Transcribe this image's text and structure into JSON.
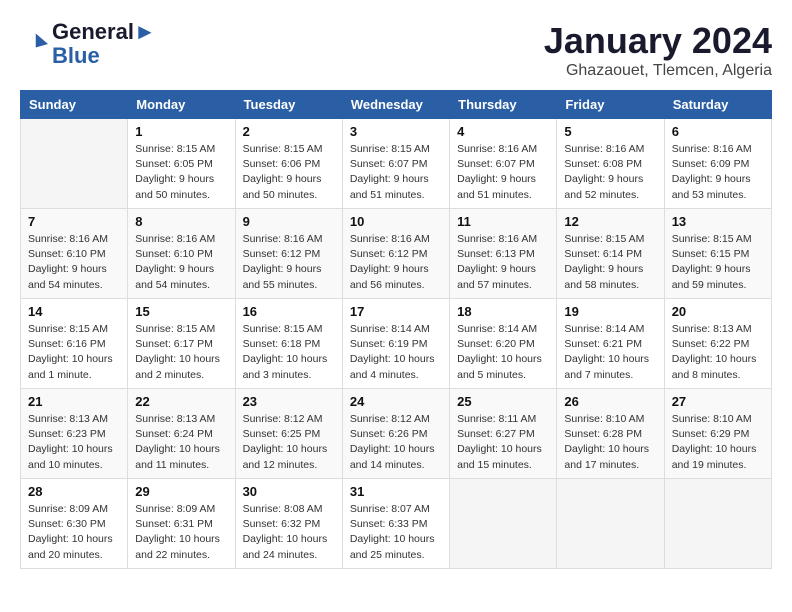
{
  "logo": {
    "line1": "General",
    "line2": "Blue"
  },
  "title": "January 2024",
  "location": "Ghazaouet, Tlemcen, Algeria",
  "days_of_week": [
    "Sunday",
    "Monday",
    "Tuesday",
    "Wednesday",
    "Thursday",
    "Friday",
    "Saturday"
  ],
  "weeks": [
    [
      {
        "day": "",
        "sunrise": "",
        "sunset": "",
        "daylight": ""
      },
      {
        "day": "1",
        "sunrise": "Sunrise: 8:15 AM",
        "sunset": "Sunset: 6:05 PM",
        "daylight": "Daylight: 9 hours and 50 minutes."
      },
      {
        "day": "2",
        "sunrise": "Sunrise: 8:15 AM",
        "sunset": "Sunset: 6:06 PM",
        "daylight": "Daylight: 9 hours and 50 minutes."
      },
      {
        "day": "3",
        "sunrise": "Sunrise: 8:15 AM",
        "sunset": "Sunset: 6:07 PM",
        "daylight": "Daylight: 9 hours and 51 minutes."
      },
      {
        "day": "4",
        "sunrise": "Sunrise: 8:16 AM",
        "sunset": "Sunset: 6:07 PM",
        "daylight": "Daylight: 9 hours and 51 minutes."
      },
      {
        "day": "5",
        "sunrise": "Sunrise: 8:16 AM",
        "sunset": "Sunset: 6:08 PM",
        "daylight": "Daylight: 9 hours and 52 minutes."
      },
      {
        "day": "6",
        "sunrise": "Sunrise: 8:16 AM",
        "sunset": "Sunset: 6:09 PM",
        "daylight": "Daylight: 9 hours and 53 minutes."
      }
    ],
    [
      {
        "day": "7",
        "sunrise": "Sunrise: 8:16 AM",
        "sunset": "Sunset: 6:10 PM",
        "daylight": "Daylight: 9 hours and 54 minutes."
      },
      {
        "day": "8",
        "sunrise": "Sunrise: 8:16 AM",
        "sunset": "Sunset: 6:10 PM",
        "daylight": "Daylight: 9 hours and 54 minutes."
      },
      {
        "day": "9",
        "sunrise": "Sunrise: 8:16 AM",
        "sunset": "Sunset: 6:12 PM",
        "daylight": "Daylight: 9 hours and 55 minutes."
      },
      {
        "day": "10",
        "sunrise": "Sunrise: 8:16 AM",
        "sunset": "Sunset: 6:12 PM",
        "daylight": "Daylight: 9 hours and 56 minutes."
      },
      {
        "day": "11",
        "sunrise": "Sunrise: 8:16 AM",
        "sunset": "Sunset: 6:13 PM",
        "daylight": "Daylight: 9 hours and 57 minutes."
      },
      {
        "day": "12",
        "sunrise": "Sunrise: 8:15 AM",
        "sunset": "Sunset: 6:14 PM",
        "daylight": "Daylight: 9 hours and 58 minutes."
      },
      {
        "day": "13",
        "sunrise": "Sunrise: 8:15 AM",
        "sunset": "Sunset: 6:15 PM",
        "daylight": "Daylight: 9 hours and 59 minutes."
      }
    ],
    [
      {
        "day": "14",
        "sunrise": "Sunrise: 8:15 AM",
        "sunset": "Sunset: 6:16 PM",
        "daylight": "Daylight: 10 hours and 1 minute."
      },
      {
        "day": "15",
        "sunrise": "Sunrise: 8:15 AM",
        "sunset": "Sunset: 6:17 PM",
        "daylight": "Daylight: 10 hours and 2 minutes."
      },
      {
        "day": "16",
        "sunrise": "Sunrise: 8:15 AM",
        "sunset": "Sunset: 6:18 PM",
        "daylight": "Daylight: 10 hours and 3 minutes."
      },
      {
        "day": "17",
        "sunrise": "Sunrise: 8:14 AM",
        "sunset": "Sunset: 6:19 PM",
        "daylight": "Daylight: 10 hours and 4 minutes."
      },
      {
        "day": "18",
        "sunrise": "Sunrise: 8:14 AM",
        "sunset": "Sunset: 6:20 PM",
        "daylight": "Daylight: 10 hours and 5 minutes."
      },
      {
        "day": "19",
        "sunrise": "Sunrise: 8:14 AM",
        "sunset": "Sunset: 6:21 PM",
        "daylight": "Daylight: 10 hours and 7 minutes."
      },
      {
        "day": "20",
        "sunrise": "Sunrise: 8:13 AM",
        "sunset": "Sunset: 6:22 PM",
        "daylight": "Daylight: 10 hours and 8 minutes."
      }
    ],
    [
      {
        "day": "21",
        "sunrise": "Sunrise: 8:13 AM",
        "sunset": "Sunset: 6:23 PM",
        "daylight": "Daylight: 10 hours and 10 minutes."
      },
      {
        "day": "22",
        "sunrise": "Sunrise: 8:13 AM",
        "sunset": "Sunset: 6:24 PM",
        "daylight": "Daylight: 10 hours and 11 minutes."
      },
      {
        "day": "23",
        "sunrise": "Sunrise: 8:12 AM",
        "sunset": "Sunset: 6:25 PM",
        "daylight": "Daylight: 10 hours and 12 minutes."
      },
      {
        "day": "24",
        "sunrise": "Sunrise: 8:12 AM",
        "sunset": "Sunset: 6:26 PM",
        "daylight": "Daylight: 10 hours and 14 minutes."
      },
      {
        "day": "25",
        "sunrise": "Sunrise: 8:11 AM",
        "sunset": "Sunset: 6:27 PM",
        "daylight": "Daylight: 10 hours and 15 minutes."
      },
      {
        "day": "26",
        "sunrise": "Sunrise: 8:10 AM",
        "sunset": "Sunset: 6:28 PM",
        "daylight": "Daylight: 10 hours and 17 minutes."
      },
      {
        "day": "27",
        "sunrise": "Sunrise: 8:10 AM",
        "sunset": "Sunset: 6:29 PM",
        "daylight": "Daylight: 10 hours and 19 minutes."
      }
    ],
    [
      {
        "day": "28",
        "sunrise": "Sunrise: 8:09 AM",
        "sunset": "Sunset: 6:30 PM",
        "daylight": "Daylight: 10 hours and 20 minutes."
      },
      {
        "day": "29",
        "sunrise": "Sunrise: 8:09 AM",
        "sunset": "Sunset: 6:31 PM",
        "daylight": "Daylight: 10 hours and 22 minutes."
      },
      {
        "day": "30",
        "sunrise": "Sunrise: 8:08 AM",
        "sunset": "Sunset: 6:32 PM",
        "daylight": "Daylight: 10 hours and 24 minutes."
      },
      {
        "day": "31",
        "sunrise": "Sunrise: 8:07 AM",
        "sunset": "Sunset: 6:33 PM",
        "daylight": "Daylight: 10 hours and 25 minutes."
      },
      {
        "day": "",
        "sunrise": "",
        "sunset": "",
        "daylight": ""
      },
      {
        "day": "",
        "sunrise": "",
        "sunset": "",
        "daylight": ""
      },
      {
        "day": "",
        "sunrise": "",
        "sunset": "",
        "daylight": ""
      }
    ]
  ]
}
